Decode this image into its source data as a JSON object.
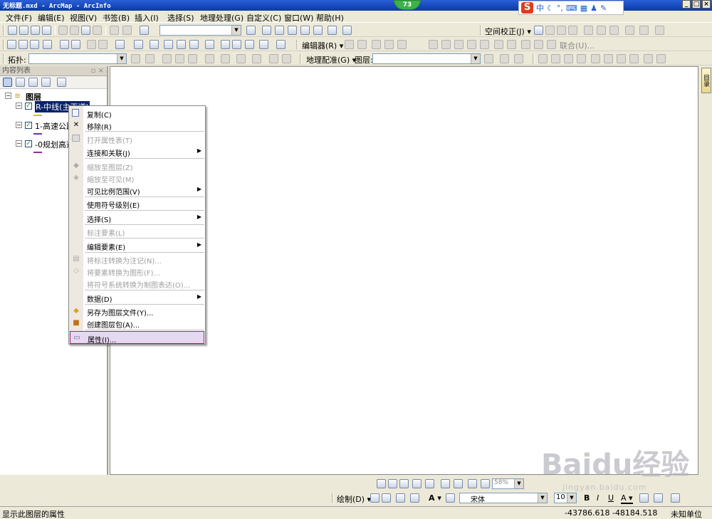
{
  "window": {
    "title": "无标题.mxd - ArcMap - ArcInfo",
    "badge": "73",
    "minimize": "_",
    "maximize": "□",
    "close": "×"
  },
  "ime": {
    "logo": "S",
    "mode": "中"
  },
  "menu": [
    "文件(F)",
    "编辑(E)",
    "视图(V)",
    "书签(B)",
    "插入(I)",
    "选择(S)",
    "地理处理(G)",
    "自定义(C)",
    "窗口(W)",
    "帮助(H)"
  ],
  "toolbars": {
    "spatial_adjust": "空间校正(J) ▾",
    "editor": "编辑器(R) ▾",
    "union": "联合(U)...",
    "topology": "拓扑:",
    "georef": "地理配准(G) ▾",
    "layer_label": "图层:"
  },
  "toc": {
    "title": "内容列表",
    "pin": "▫ ×",
    "root": "图层",
    "layers": [
      {
        "name": "R-中线(主干道)",
        "color": "#c8c800"
      },
      {
        "name": "1-高速公路",
        "color": "#7a2ab0"
      },
      {
        "name": "-0规划高速",
        "color": "#9a2aa0"
      }
    ]
  },
  "context_menu": {
    "items": [
      {
        "label": "复制(C)",
        "enabled": true,
        "submenu": false,
        "icon": "copy-icon"
      },
      {
        "label": "移除(R)",
        "enabled": true,
        "submenu": false,
        "icon": "remove-icon"
      },
      {
        "label": "打开属性表(T)",
        "enabled": false,
        "submenu": false,
        "icon": "table-icon"
      },
      {
        "label": "连接和关联(J)",
        "enabled": true,
        "submenu": true,
        "icon": ""
      },
      {
        "label": "缩放至图层(Z)",
        "enabled": false,
        "submenu": false,
        "icon": "zoom-layer-icon"
      },
      {
        "label": "缩放至可见(M)",
        "enabled": false,
        "submenu": false,
        "icon": "zoom-visible-icon"
      },
      {
        "label": "可见比例范围(V)",
        "enabled": true,
        "submenu": true,
        "icon": ""
      },
      {
        "label": "使用符号级别(E)",
        "enabled": true,
        "submenu": false,
        "icon": ""
      },
      {
        "label": "选择(S)",
        "enabled": true,
        "submenu": true,
        "icon": ""
      },
      {
        "label": "标注要素(L)",
        "enabled": false,
        "submenu": false,
        "icon": ""
      },
      {
        "label": "编辑要素(E)",
        "enabled": true,
        "submenu": true,
        "icon": ""
      },
      {
        "label": "将标注转换为注记(N)...",
        "enabled": false,
        "submenu": false,
        "icon": "convert-label-icon"
      },
      {
        "label": "将要素转换为图形(F)...",
        "enabled": false,
        "submenu": false,
        "icon": "convert-graphic-icon"
      },
      {
        "label": "将符号系统转换为制图表达(O)...",
        "enabled": false,
        "submenu": false,
        "icon": ""
      },
      {
        "label": "数据(D)",
        "enabled": true,
        "submenu": true,
        "icon": ""
      },
      {
        "label": "另存为图层文件(Y)...",
        "enabled": true,
        "submenu": false,
        "icon": "layer-file-icon"
      },
      {
        "label": "创建图层包(A)...",
        "enabled": true,
        "submenu": false,
        "icon": "layer-package-icon"
      },
      {
        "label": "属性(I)...",
        "enabled": true,
        "submenu": false,
        "icon": "properties-icon",
        "highlighted": true
      }
    ]
  },
  "drawing": {
    "draw_label": "绘制(D) ▾",
    "font": "宋体",
    "font_size": "10",
    "zoom": "58%"
  },
  "status": {
    "message": "显示此图层的属性",
    "coords": "-43786.618  -48184.518",
    "units": "未知单位"
  },
  "dock": {
    "tab": "目录"
  },
  "watermark": {
    "text": "Baidu经验",
    "url": "jingyan.baidu.com"
  }
}
